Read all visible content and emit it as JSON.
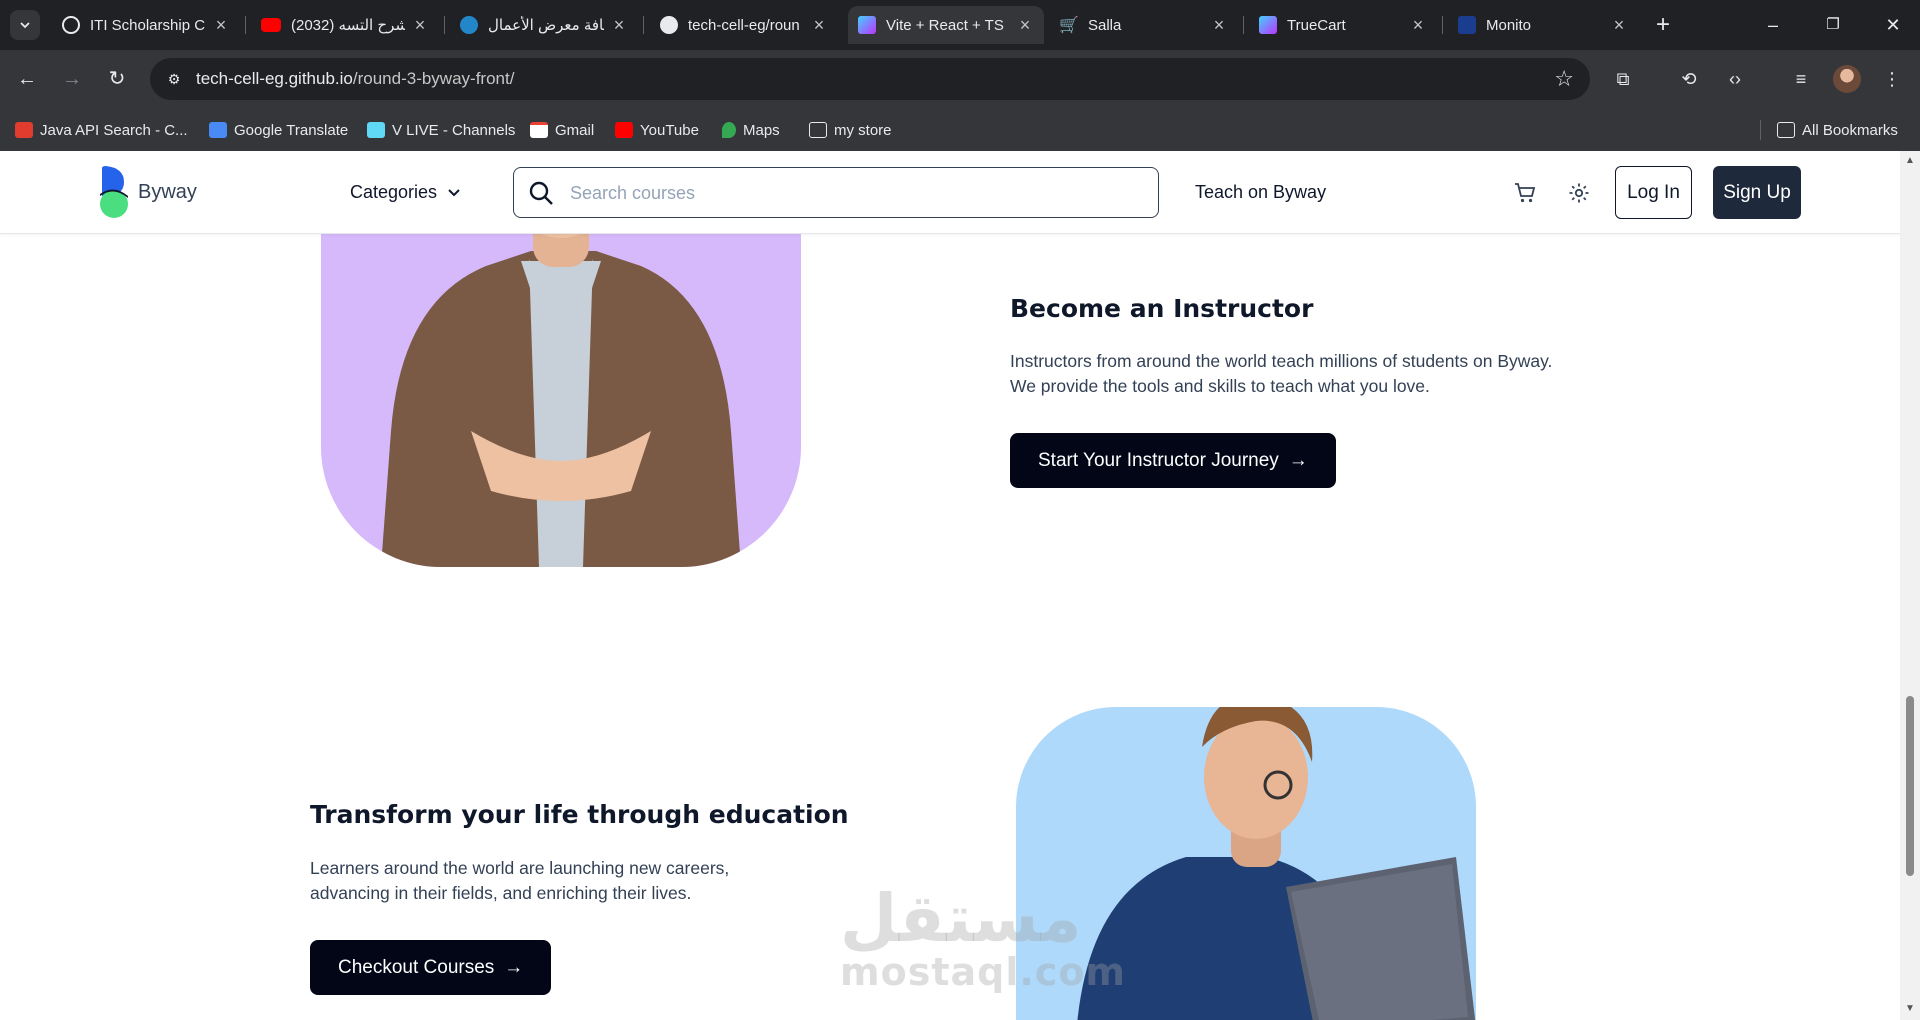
{
  "browser": {
    "tabs": [
      {
        "title": "ITI Scholarship C",
        "active": false
      },
      {
        "title": "(2032) شرح التسه",
        "active": false
      },
      {
        "title": "إضافة معرض الأعمال",
        "active": false
      },
      {
        "title": "tech-cell-eg/roun",
        "active": false
      },
      {
        "title": "Vite + React + TS",
        "active": true
      },
      {
        "title": "Salla",
        "active": false
      },
      {
        "title": "TrueCart",
        "active": false
      },
      {
        "title": "Monito",
        "active": false
      }
    ],
    "url_host": "tech-cell-eg.github.io",
    "url_path": "/round-3-byway-front/",
    "bookmarks": [
      {
        "label": "Java API Search - C..."
      },
      {
        "label": "Google Translate"
      },
      {
        "label": "V LIVE - Channels"
      },
      {
        "label": "Gmail"
      },
      {
        "label": "YouTube"
      },
      {
        "label": "Maps"
      },
      {
        "label": "my store"
      }
    ],
    "all_bookmarks": "All Bookmarks"
  },
  "header": {
    "brand": "Byway",
    "categories": "Categories",
    "search_placeholder": "Search courses",
    "teach": "Teach on Byway",
    "login": "Log In",
    "signup": "Sign Up"
  },
  "instructor": {
    "title": "Become an Instructor",
    "line1": "Instructors from around the world teach millions of students on Byway.",
    "line2": "We provide the tools and skills to teach what you love.",
    "cta": "Start Your Instructor Journey"
  },
  "transform": {
    "title": "Transform your life through education",
    "line1": "Learners around the world are launching new careers,",
    "line2": "advancing in their fields, and enriching their lives.",
    "cta": "Checkout Courses"
  },
  "watermark": {
    "arabic": "مستقل",
    "latin": "mostaql.com"
  },
  "colors": {
    "instructor_bg": "#d6b9fb",
    "transform_bg": "#aed9fb",
    "cta_bg": "#020617",
    "signup_bg": "#1e293b"
  }
}
